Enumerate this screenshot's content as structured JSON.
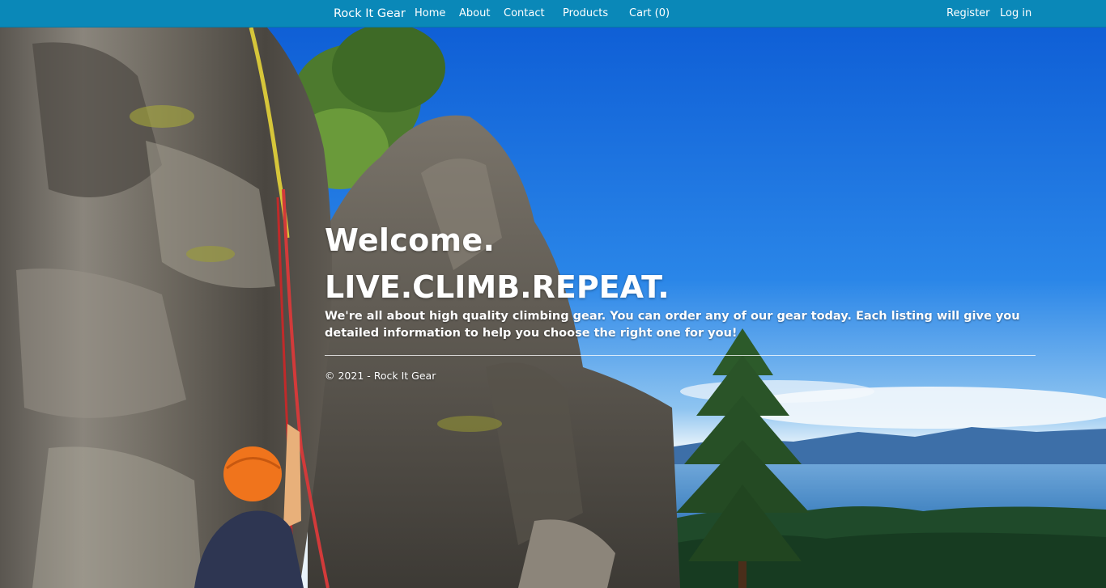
{
  "nav": {
    "brand": "Rock It Gear",
    "links": {
      "home": "Home",
      "about": "About",
      "contact": "Contact",
      "products": "Products",
      "cart": "Cart (0)",
      "register": "Register",
      "login": "Log in"
    }
  },
  "hero": {
    "welcome": "Welcome.",
    "tagline": "LIVE.CLIMB.REPEAT.",
    "lead": "We're all about high quality climbing gear. You can order any of our gear today. Each listing will give you detailed information to help you choose the right one for you!",
    "footer": "© 2021 - Rock It Gear"
  },
  "colors": {
    "navbar": "#0a88b8",
    "sky": "#1e6fd0",
    "text": "#ffffff"
  }
}
